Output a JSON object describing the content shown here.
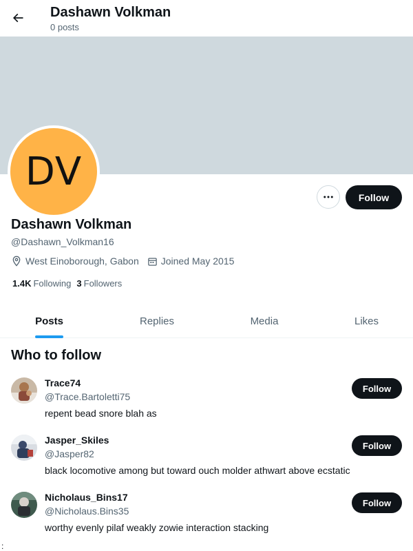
{
  "header": {
    "title": "Dashawn Volkman",
    "posts_count": "0 posts"
  },
  "profile": {
    "avatar_initials": "DV",
    "name": "Dashawn Volkman",
    "handle": "@Dashawn_Volkman16",
    "location": "West Einoborough, Gabon",
    "joined": "Joined May 2015",
    "following_count": "1.4K",
    "following_label": "Following",
    "followers_count": "3",
    "followers_label": "Followers",
    "follow_label": "Follow"
  },
  "tabs": [
    {
      "label": "Posts",
      "active": true
    },
    {
      "label": "Replies",
      "active": false
    },
    {
      "label": "Media",
      "active": false
    },
    {
      "label": "Likes",
      "active": false
    }
  ],
  "who_to_follow": {
    "title": "Who to follow",
    "users": [
      {
        "name": "Trace74",
        "handle": "@Trace.Bartoletti75",
        "bio": "repent bead snore blah as",
        "follow_label": "Follow"
      },
      {
        "name": "Jasper_Skiles",
        "handle": "@Jasper82",
        "bio": "black locomotive among but toward ouch molder athwart above ecstatic",
        "follow_label": "Follow"
      },
      {
        "name": "Nicholaus_Bins17",
        "handle": "@Nicholaus.Bins35",
        "bio": "worthy evenly pilaf weakly zowie interaction stacking",
        "follow_label": "Follow"
      }
    ]
  },
  "stray_text": ":",
  "colors": {
    "accent": "#1d9bf0",
    "banner": "#cfd9de",
    "avatar_bg": "#ffb347",
    "button_bg": "#0f1419"
  },
  "icons": {
    "back": "arrow-left-icon",
    "more": "more-horizontal-icon",
    "location": "location-pin-icon",
    "calendar": "calendar-icon"
  }
}
